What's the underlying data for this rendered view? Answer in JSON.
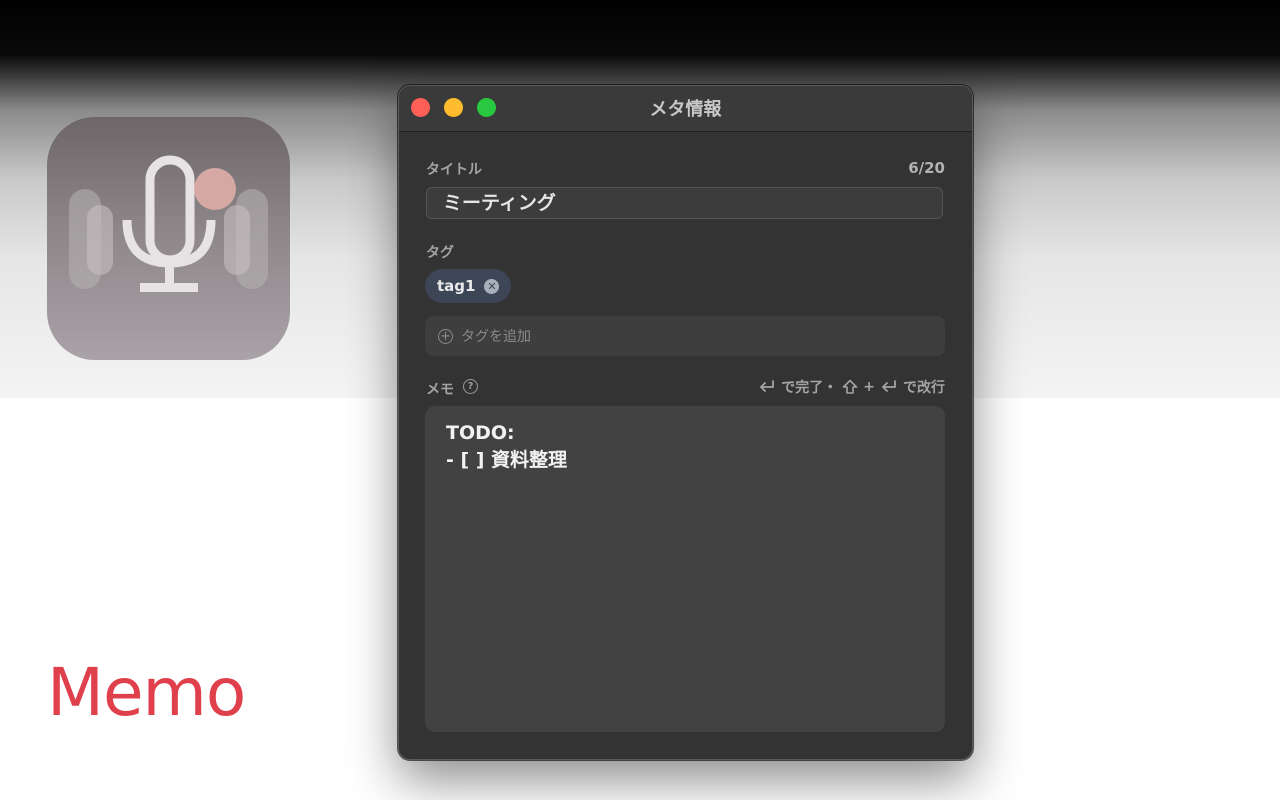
{
  "window": {
    "title": "メタ情報"
  },
  "title_field": {
    "label": "タイトル",
    "counter": "6/20",
    "value": "ミーティング"
  },
  "tags": {
    "label": "タグ",
    "items": [
      {
        "label": "tag1"
      }
    ],
    "add_placeholder": "タグを追加"
  },
  "memo": {
    "label": "メモ",
    "hint_done": "で完了・",
    "hint_plus": "+",
    "hint_newline": "で改行",
    "lines": [
      "TODO:",
      "- [ ] 資料整理"
    ]
  },
  "brand": {
    "text": "Memo",
    "color": "#e0404c"
  },
  "colors": {
    "window_bg": "#333333",
    "input_bg": "#3c3c3c",
    "tag_bg": "#3d4656",
    "close": "#fe5f57",
    "minimize": "#febc2e",
    "maximize": "#28c840"
  }
}
